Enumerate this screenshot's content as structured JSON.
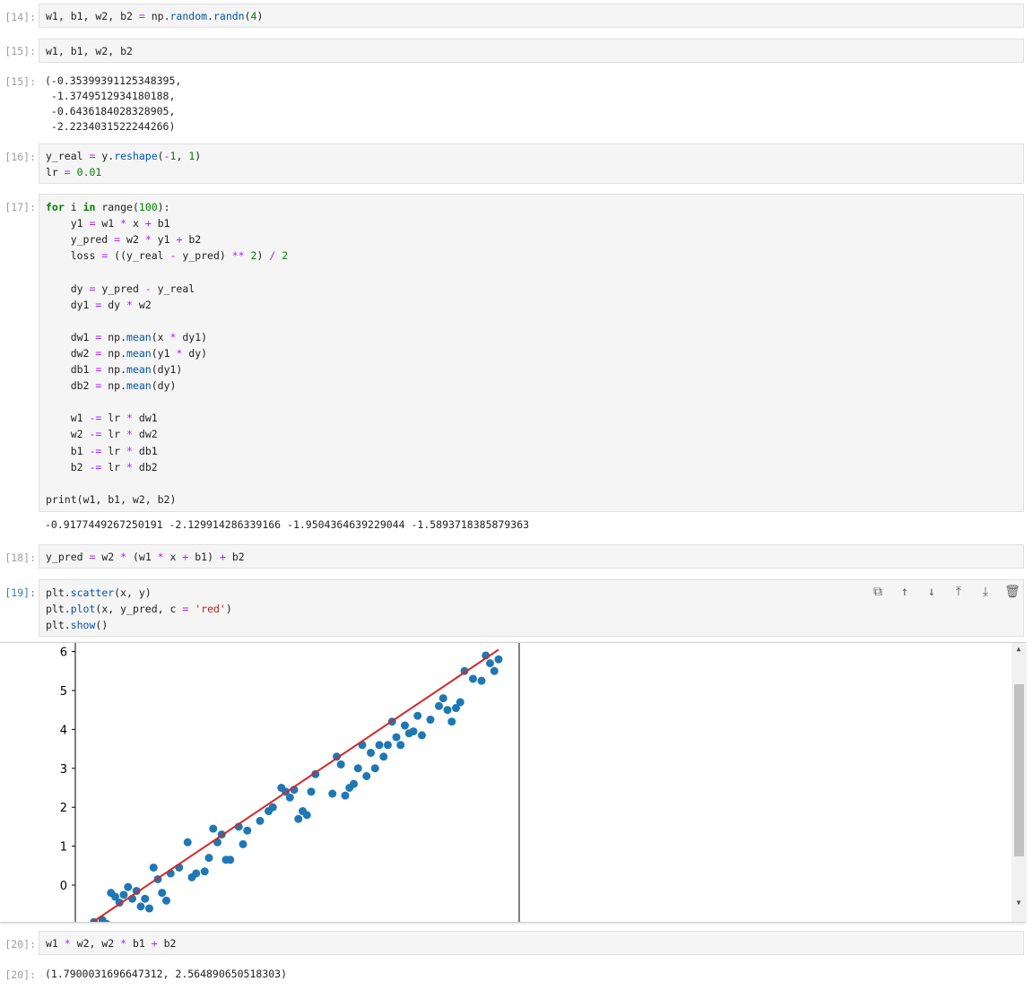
{
  "cells": [
    {
      "prompt": "[14]:",
      "lines": [
        [
          [
            "w1, b1, w2, b2 ",
            ""
          ],
          [
            "=",
            "op"
          ],
          [
            " np.",
            ""
          ],
          [
            "random",
            "fn"
          ],
          [
            ".",
            ""
          ],
          [
            "randn",
            "fn"
          ],
          [
            "(",
            ""
          ],
          [
            "4",
            "num"
          ],
          [
            ")",
            ""
          ]
        ]
      ]
    },
    {
      "prompt": "[15]:",
      "lines": [
        [
          [
            "w1, b1, w2, b2",
            ""
          ]
        ]
      ]
    },
    {
      "prompt": "[16]:",
      "lines": [
        [
          [
            "y_real ",
            ""
          ],
          [
            "=",
            "op"
          ],
          [
            " y.",
            ""
          ],
          [
            "reshape",
            "fn"
          ],
          [
            "(",
            ""
          ],
          [
            "-",
            "op"
          ],
          [
            "1",
            "num"
          ],
          [
            ", ",
            ""
          ],
          [
            "1",
            "num"
          ],
          [
            ")",
            ""
          ]
        ],
        [
          [
            "lr ",
            ""
          ],
          [
            "=",
            "op"
          ],
          [
            " ",
            ""
          ],
          [
            "0.01",
            "num"
          ]
        ]
      ]
    },
    {
      "prompt": "[17]:",
      "lines": [
        [
          [
            "for",
            "kw"
          ],
          [
            " i ",
            ""
          ],
          [
            "in",
            "kw"
          ],
          [
            " range(",
            ""
          ],
          [
            "100",
            "num"
          ],
          [
            "):",
            ""
          ]
        ],
        [
          [
            "    y1 ",
            ""
          ],
          [
            "=",
            "op"
          ],
          [
            " w1 ",
            ""
          ],
          [
            "*",
            "op"
          ],
          [
            " x ",
            ""
          ],
          [
            "+",
            "op"
          ],
          [
            " b1",
            ""
          ]
        ],
        [
          [
            "    y_pred ",
            ""
          ],
          [
            "=",
            "op"
          ],
          [
            " w2 ",
            ""
          ],
          [
            "*",
            "op"
          ],
          [
            " y1 ",
            ""
          ],
          [
            "+",
            "op"
          ],
          [
            " b2",
            ""
          ]
        ],
        [
          [
            "    loss ",
            ""
          ],
          [
            "=",
            "op"
          ],
          [
            " ((y_real ",
            ""
          ],
          [
            "-",
            "op"
          ],
          [
            " y_pred) ",
            ""
          ],
          [
            "**",
            "op"
          ],
          [
            " ",
            ""
          ],
          [
            "2",
            "num"
          ],
          [
            ") ",
            ""
          ],
          [
            "/",
            "op"
          ],
          [
            " ",
            ""
          ],
          [
            "2",
            "num"
          ]
        ],
        [
          [
            "",
            ""
          ]
        ],
        [
          [
            "    dy ",
            ""
          ],
          [
            "=",
            "op"
          ],
          [
            " y_pred ",
            ""
          ],
          [
            "-",
            "op"
          ],
          [
            " y_real",
            ""
          ]
        ],
        [
          [
            "    dy1 ",
            ""
          ],
          [
            "=",
            "op"
          ],
          [
            " dy ",
            ""
          ],
          [
            "*",
            "op"
          ],
          [
            " w2",
            ""
          ]
        ],
        [
          [
            "",
            ""
          ]
        ],
        [
          [
            "    dw1 ",
            ""
          ],
          [
            "=",
            "op"
          ],
          [
            " np.",
            ""
          ],
          [
            "mean",
            "fn"
          ],
          [
            "(x ",
            ""
          ],
          [
            "*",
            "op"
          ],
          [
            " dy1)",
            ""
          ]
        ],
        [
          [
            "    dw2 ",
            ""
          ],
          [
            "=",
            "op"
          ],
          [
            " np.",
            ""
          ],
          [
            "mean",
            "fn"
          ],
          [
            "(y1 ",
            ""
          ],
          [
            "*",
            "op"
          ],
          [
            " dy)",
            ""
          ]
        ],
        [
          [
            "    db1 ",
            ""
          ],
          [
            "=",
            "op"
          ],
          [
            " np.",
            ""
          ],
          [
            "mean",
            "fn"
          ],
          [
            "(dy1)",
            ""
          ]
        ],
        [
          [
            "    db2 ",
            ""
          ],
          [
            "=",
            "op"
          ],
          [
            " np.",
            ""
          ],
          [
            "mean",
            "fn"
          ],
          [
            "(dy)",
            ""
          ]
        ],
        [
          [
            "",
            ""
          ]
        ],
        [
          [
            "    w1 ",
            ""
          ],
          [
            "-=",
            "op"
          ],
          [
            " lr ",
            ""
          ],
          [
            "*",
            "op"
          ],
          [
            " dw1",
            ""
          ]
        ],
        [
          [
            "    w2 ",
            ""
          ],
          [
            "-=",
            "op"
          ],
          [
            " lr ",
            ""
          ],
          [
            "*",
            "op"
          ],
          [
            " dw2",
            ""
          ]
        ],
        [
          [
            "    b1 ",
            ""
          ],
          [
            "-=",
            "op"
          ],
          [
            " lr ",
            ""
          ],
          [
            "*",
            "op"
          ],
          [
            " db1",
            ""
          ]
        ],
        [
          [
            "    b2 ",
            ""
          ],
          [
            "-=",
            "op"
          ],
          [
            " lr ",
            ""
          ],
          [
            "*",
            "op"
          ],
          [
            " db2",
            ""
          ]
        ],
        [
          [
            "",
            ""
          ]
        ],
        [
          [
            "print(w1, b1, w2, b2)",
            ""
          ]
        ]
      ]
    },
    {
      "prompt": "[18]:",
      "lines": [
        [
          [
            "y_pred ",
            ""
          ],
          [
            "=",
            "op"
          ],
          [
            " w2 ",
            ""
          ],
          [
            "*",
            "op"
          ],
          [
            " (w1 ",
            ""
          ],
          [
            "*",
            "op"
          ],
          [
            " x ",
            ""
          ],
          [
            "+",
            "op"
          ],
          [
            " b1) ",
            ""
          ],
          [
            "+",
            "op"
          ],
          [
            " b2",
            ""
          ]
        ]
      ]
    },
    {
      "prompt": "[19]:",
      "lines": [
        [
          [
            "plt.",
            ""
          ],
          [
            "scatter",
            "fn"
          ],
          [
            "(x, y)",
            ""
          ]
        ],
        [
          [
            "plt.",
            ""
          ],
          [
            "plot",
            "fn"
          ],
          [
            "(x, y_pred, c ",
            ""
          ],
          [
            "=",
            "op"
          ],
          [
            " ",
            ""
          ],
          [
            "'red'",
            "str"
          ],
          [
            ")",
            ""
          ]
        ],
        [
          [
            "plt.",
            ""
          ],
          [
            "show",
            "fn"
          ],
          [
            "()",
            ""
          ]
        ]
      ]
    },
    {
      "prompt": "[20]:",
      "lines": [
        [
          [
            "w1 ",
            ""
          ],
          [
            "*",
            "op"
          ],
          [
            " w2, w2 ",
            ""
          ],
          [
            "*",
            "op"
          ],
          [
            " b1 ",
            ""
          ],
          [
            "+",
            "op"
          ],
          [
            " b2",
            ""
          ]
        ]
      ]
    }
  ],
  "outputs": {
    "out15_prompt": "[15]:",
    "out15": [
      "(-0.35399391125348395,",
      " -1.3749512934180188,",
      " -0.6436184028328905,",
      " -2.2234031522244266)"
    ],
    "out17": "-0.9177449267250191 -2.129914286339166 -1.9504364639229044 -1.5893718385879363",
    "out20_prompt": "[20]:",
    "out20": "(1.7900031696647312, 2.564890650518303)"
  },
  "toolbar": {
    "icons": [
      "copy-icon",
      "move-up-icon",
      "move-down-icon",
      "insert-above-icon",
      "insert-below-icon",
      "delete-icon"
    ],
    "glyphs": [
      "⧉",
      "↑",
      "↓",
      "⤒",
      "⤓",
      "🗑"
    ]
  },
  "chart_data": {
    "type": "scatter",
    "title": "",
    "xlabel": "",
    "ylabel": "",
    "ylim_visible": [
      -1,
      6.2
    ],
    "yticks": [
      "6",
      "5",
      "4",
      "3",
      "2",
      "1",
      "0"
    ],
    "scatter_color": "#1f77b4",
    "line_color": "#d62728",
    "line": {
      "x": [
        0.04,
        1.0
      ],
      "y": [
        -1.0,
        6.05
      ]
    },
    "points": [
      [
        0.05,
        -0.95
      ],
      [
        0.07,
        -0.9
      ],
      [
        0.08,
        -1.0
      ],
      [
        0.09,
        -0.2
      ],
      [
        0.1,
        -0.3
      ],
      [
        0.11,
        -0.45
      ],
      [
        0.12,
        -0.25
      ],
      [
        0.13,
        -0.05
      ],
      [
        0.14,
        -0.35
      ],
      [
        0.15,
        -0.15
      ],
      [
        0.16,
        -0.55
      ],
      [
        0.17,
        -0.35
      ],
      [
        0.18,
        -0.6
      ],
      [
        0.19,
        0.45
      ],
      [
        0.2,
        0.15
      ],
      [
        0.21,
        -0.2
      ],
      [
        0.22,
        -0.4
      ],
      [
        0.23,
        0.3
      ],
      [
        0.25,
        0.45
      ],
      [
        0.27,
        1.1
      ],
      [
        0.28,
        0.2
      ],
      [
        0.29,
        0.3
      ],
      [
        0.31,
        0.35
      ],
      [
        0.32,
        0.7
      ],
      [
        0.33,
        1.45
      ],
      [
        0.34,
        1.1
      ],
      [
        0.35,
        1.3
      ],
      [
        0.36,
        0.65
      ],
      [
        0.37,
        0.65
      ],
      [
        0.39,
        1.5
      ],
      [
        0.4,
        1.05
      ],
      [
        0.41,
        1.4
      ],
      [
        0.44,
        1.65
      ],
      [
        0.46,
        1.9
      ],
      [
        0.47,
        2.0
      ],
      [
        0.49,
        2.5
      ],
      [
        0.5,
        2.4
      ],
      [
        0.51,
        2.25
      ],
      [
        0.52,
        2.45
      ],
      [
        0.53,
        1.7
      ],
      [
        0.54,
        1.9
      ],
      [
        0.55,
        1.8
      ],
      [
        0.56,
        2.4
      ],
      [
        0.57,
        2.85
      ],
      [
        0.61,
        2.35
      ],
      [
        0.62,
        3.3
      ],
      [
        0.63,
        3.1
      ],
      [
        0.64,
        2.3
      ],
      [
        0.65,
        2.5
      ],
      [
        0.66,
        2.6
      ],
      [
        0.67,
        3.0
      ],
      [
        0.68,
        3.6
      ],
      [
        0.69,
        2.8
      ],
      [
        0.7,
        3.4
      ],
      [
        0.71,
        3.0
      ],
      [
        0.72,
        3.6
      ],
      [
        0.73,
        3.3
      ],
      [
        0.74,
        3.6
      ],
      [
        0.75,
        4.2
      ],
      [
        0.76,
        3.8
      ],
      [
        0.77,
        3.6
      ],
      [
        0.78,
        4.1
      ],
      [
        0.79,
        3.9
      ],
      [
        0.8,
        3.95
      ],
      [
        0.81,
        4.35
      ],
      [
        0.82,
        3.85
      ],
      [
        0.84,
        4.25
      ],
      [
        0.86,
        4.6
      ],
      [
        0.87,
        4.8
      ],
      [
        0.88,
        4.5
      ],
      [
        0.89,
        4.2
      ],
      [
        0.9,
        4.55
      ],
      [
        0.91,
        4.7
      ],
      [
        0.92,
        5.5
      ],
      [
        0.94,
        5.3
      ],
      [
        0.96,
        5.25
      ],
      [
        0.97,
        5.9
      ],
      [
        0.98,
        5.7
      ],
      [
        0.99,
        5.5
      ],
      [
        1.0,
        5.8
      ]
    ]
  }
}
